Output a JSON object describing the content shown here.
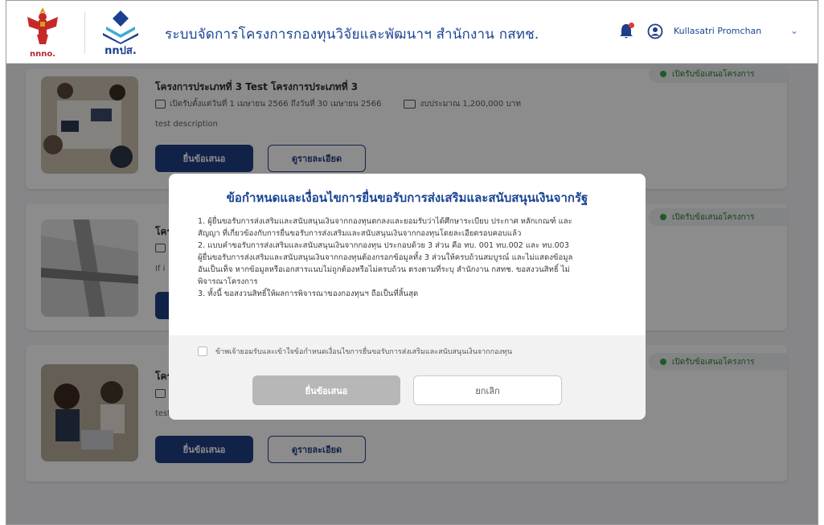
{
  "header": {
    "logo_left_caption": "nnno.",
    "logo_right_caption": "nnปส.",
    "title": "ระบบจัดการโครงการกองทุนวิจัยและพัฒนาฯ สำนักงาน กสทช.",
    "user_name": "Kullasatri Promchan",
    "colors": {
      "brand_blue": "#1a4493",
      "accent_red": "#b3272d",
      "notification_dot": "#e53935"
    },
    "icons": [
      "garuda-emblem",
      "tpst-logo",
      "bell-icon",
      "user-circle-icon",
      "chevron-down-icon"
    ]
  },
  "cards": [
    {
      "title": "โครงการประเภทที่ 3 Test โครงการประเภทที่ 3",
      "period": "เปิดรับตั้งแต่วันที่ 1 เมษายน 2566 ถึงวันที่ 30 เมษายน 2566",
      "budget": "งบประมาณ 1,200,000 บาท",
      "description": "test description",
      "submit_label": "ยื่นข้อเสนอ",
      "detail_label": "ดูรายละเอียด",
      "status": "เปิดรับข้อเสนอโครงการ"
    },
    {
      "title": "โคร",
      "description": "If i",
      "status": "เปิดรับข้อเสนอโครงการ"
    },
    {
      "title": "โคร",
      "description": "test",
      "submit_label": "ยื่นข้อเสนอ",
      "detail_label": "ดูรายละเอียด",
      "status": "เปิดรับข้อเสนอโครงการ"
    }
  ],
  "modal": {
    "title": "ข้อกำหนดและเงื่อนไขการยื่นขอรับการส่งเสริมและสนับสนุนเงินจากรัฐ",
    "lines": [
      "1. ผู้ยื่นขอรับการส่งเสริมและสนับสนุนเงินจากกองทุนตกลงและยอมรับว่าได้ศึกษาระเบียบ ประกาศ หลักเกณฑ์ และ",
      "สัญญา ที่เกี่ยวข้องกับการยื่นขอรับการส่งเสริมและสนับสนุนเงินจากกองทุนโดยละเอียดรอบคอบแล้ว",
      "2. แบบคำขอรับการส่งเสริมและสนับสนุนเงินจากกองทุน ประกอบด้วย 3 ส่วน คือ ทบ. 001 ทบ.002 และ ทบ.003",
      "ผู้ยื่นขอรับการส่งเสริมและสนับสนุนเงินจากกองทุนต้องกรอกข้อมูลทั้ง 3 ส่วนให้ครบถ้วนสมบูรณ์ และไม่แสดงข้อมูล",
      "อันเป็นเท็จ หากข้อมูลหรือเอกสารแนบไม่ถูกต้องหรือไม่ครบถ้วน ตรงตามที่ระบุ สำนักงาน กสทช. ขอสงวนสิทธิ์ ไม่",
      "พิจารณาโครงการ",
      "3. ทั้งนี้ ขอสงวนสิทธิ์ให้ผลการพิจารณาของกองทุนฯ ถือเป็นที่สิ้นสุด"
    ],
    "agree_label": "ข้าพเจ้ายอมรับและเข้าใจข้อกำหนดเงื่อนไขการยื่นขอรับการส่งเสริมและสนับสนุนเงินจากกองทุน",
    "agree_checked": false,
    "submit_label": "ยื่นข้อเสนอ",
    "cancel_label": "ยกเลิก"
  }
}
